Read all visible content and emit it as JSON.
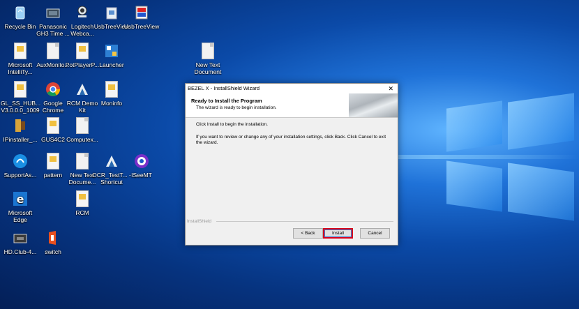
{
  "desktop_icons": [
    {
      "label": "Recycle Bin",
      "x": 0
    },
    {
      "label": "Panasonic GH3 Time ..."
    },
    {
      "label": "Logitech Webca..."
    },
    {
      "label": "UsbTreeView"
    },
    {
      "label": "UsbTreeView"
    },
    {
      "label": "Microsoft IntelliTy..."
    },
    {
      "label": "AuxMonito..."
    },
    {
      "label": "PotPlayerP..."
    },
    {
      "label": "Launcher"
    },
    {
      "label": "New Text Document"
    },
    {
      "label": "GL_SS_HUB... V3.0.0.0_1009"
    },
    {
      "label": "Google Chrome"
    },
    {
      "label": "RCM Demo Kit"
    },
    {
      "label": "Moninfo"
    },
    {
      "label": "IPinstaller_..."
    },
    {
      "label": "GUS4C2"
    },
    {
      "label": "Computex..."
    },
    {
      "label": "SupportAs..."
    },
    {
      "label": "pattern"
    },
    {
      "label": "New Text Docume..."
    },
    {
      "label": "OCR_TestT... - Shortcut"
    },
    {
      "label": "ISeeMT"
    },
    {
      "label": "Microsoft Edge"
    },
    {
      "label": "RCM"
    },
    {
      "label": "HD.Club-4..."
    },
    {
      "label": "switch"
    }
  ],
  "dialog": {
    "title": "BEZEL X - InstallShield Wizard",
    "close": "✕",
    "header_title": "Ready to Install the Program",
    "header_subtitle": "The wizard is ready to begin installation.",
    "line1": "Click Install to begin the installation.",
    "line2": "If you want to review or change any of your installation settings, click Back. Click Cancel to exit the wizard.",
    "brand": "InstallShield",
    "back_label": "< Back",
    "install_label": "Install",
    "cancel_label": "Cancel"
  }
}
